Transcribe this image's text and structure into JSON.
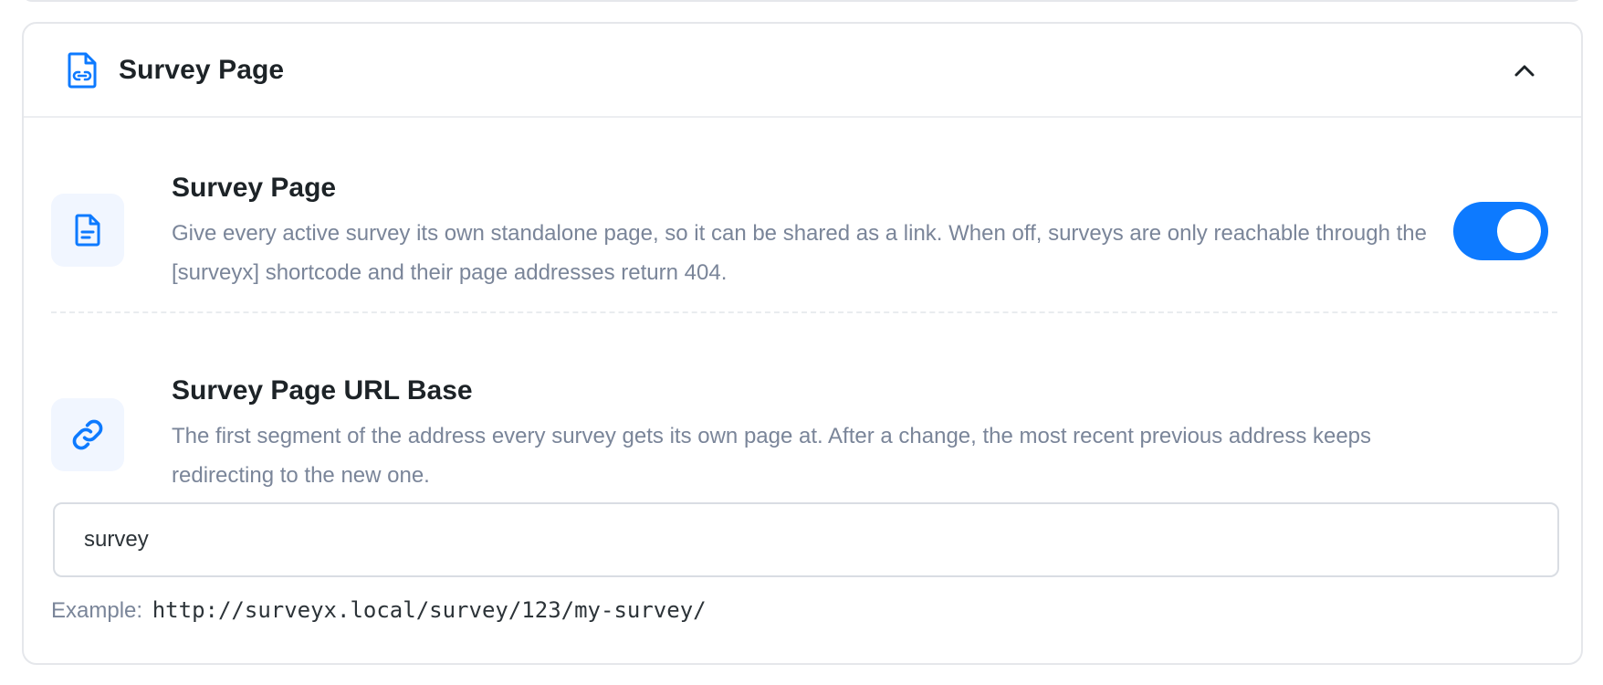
{
  "section": {
    "title": "Survey Page",
    "header_icon": "file-link-icon",
    "collapse_icon": "chevron-up-icon"
  },
  "settings": [
    {
      "title": "Survey Page",
      "description": "Give every active survey its own standalone page, so it can be shared as a link. When off, surveys are only reachable through the [surveyx] shortcode and their page addresses return 404.",
      "icon": "document-icon",
      "toggle_on": true
    },
    {
      "title": "Survey Page URL Base",
      "description": "The first segment of the address every survey gets its own page at. After a change, the most recent previous address keeps redirecting to the new one.",
      "icon": "link-icon",
      "input_value": "survey"
    }
  ],
  "example": {
    "label": "Example:",
    "url": "http://surveyx.local/survey/123/my-survey/"
  },
  "colors": {
    "accent": "#0d7aff",
    "muted_text": "#7a8599",
    "icon_bg": "#f1f6ff"
  }
}
